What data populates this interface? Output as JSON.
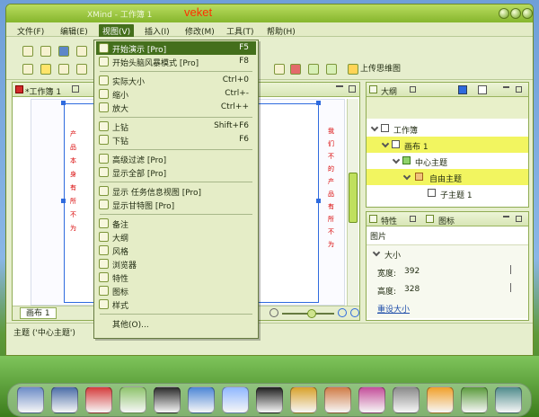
{
  "window": {
    "title": "XMind - 工作簿 1",
    "overlay": "veket"
  },
  "menu": {
    "items": [
      "文件(F)",
      "编辑(E)",
      "视图(V)",
      "插入(I)",
      "修改(M)",
      "工具(T)",
      "帮助(H)"
    ],
    "active_index": 2
  },
  "toolbar": {
    "upload_label": "上传思维图"
  },
  "editor": {
    "tab_label": "*工作簿 1",
    "sheet_tab": "画布 1",
    "red_left": "产 品 本 身 有 所 不 为",
    "red_right": "我 们 不 的 产 品 有 所 不 为"
  },
  "dropdown": {
    "items": [
      {
        "label": "开始演示 [Pro]",
        "shortcut": "F5",
        "icon": "presentation-icon",
        "hover": true
      },
      {
        "label": "开始头脑风暴模式 [Pro]",
        "shortcut": "F8",
        "icon": "brainstorm-icon"
      },
      {
        "separator": true
      },
      {
        "label": "实际大小",
        "shortcut": "Ctrl+0",
        "icon": "actual-size-icon"
      },
      {
        "label": "缩小",
        "shortcut": "Ctrl+-",
        "icon": "zoom-out-icon"
      },
      {
        "label": "放大",
        "shortcut": "Ctrl++",
        "icon": "zoom-in-icon"
      },
      {
        "separator": true
      },
      {
        "label": "上钻",
        "shortcut": "Shift+F6",
        "icon": "drill-up-icon"
      },
      {
        "label": "下钻",
        "shortcut": "F6",
        "icon": "drill-down-icon"
      },
      {
        "separator": true
      },
      {
        "label": "高级过滤 [Pro]",
        "shortcut": "",
        "icon": "filter-icon"
      },
      {
        "label": "显示全部 [Pro]",
        "shortcut": "",
        "icon": "show-all-icon"
      },
      {
        "separator": true
      },
      {
        "label": "显示 任务信息视图 [Pro]",
        "shortcut": "",
        "icon": "task-info-icon"
      },
      {
        "label": "显示甘特图 [Pro]",
        "shortcut": "",
        "icon": "gantt-icon"
      },
      {
        "separator": true
      },
      {
        "label": "备注",
        "shortcut": "",
        "icon": "notes-icon"
      },
      {
        "label": "大纲",
        "shortcut": "",
        "icon": "outline-icon"
      },
      {
        "label": "风格",
        "shortcut": "",
        "icon": "style-icon"
      },
      {
        "label": "浏览器",
        "shortcut": "",
        "icon": "browser-icon"
      },
      {
        "label": "特性",
        "shortcut": "",
        "icon": "properties-icon"
      },
      {
        "label": "图标",
        "shortcut": "",
        "icon": "markers-icon"
      },
      {
        "label": "样式",
        "shortcut": "",
        "icon": "palette-icon"
      },
      {
        "separator": true
      },
      {
        "label": "其他(O)...",
        "shortcut": "",
        "icon": ""
      }
    ]
  },
  "outline": {
    "title": "大纲",
    "rows": [
      {
        "label": "工作簿",
        "level": 0,
        "highlight": false
      },
      {
        "label": "画布 1",
        "level": 1,
        "highlight": true
      },
      {
        "label": "中心主题",
        "level": 2,
        "highlight": false
      },
      {
        "label": "自由主题",
        "level": 3,
        "highlight": true
      },
      {
        "label": "子主题 1",
        "level": 4,
        "highlight": false
      }
    ]
  },
  "properties": {
    "tabs": [
      "特性",
      "图标"
    ],
    "section": "图片",
    "group": "大小",
    "width_label": "宽度:",
    "width_value": "392",
    "height_label": "高度:",
    "height_value": "328",
    "reset_link": "重设大小"
  },
  "status": {
    "text": "主题 ('中心主题')"
  },
  "dock": {
    "items": [
      "paint-icon",
      "monitor-icon",
      "pet-icon",
      "notes-icon",
      "media-player-icon",
      "media-icon",
      "users-icon",
      "tux-icon",
      "folder-icon",
      "image-viewer-icon",
      "art-icon",
      "cable-icon",
      "paint-tool-icon",
      "recycle-icon",
      "camera-icon"
    ]
  },
  "colors": {
    "accent": "#446f1c",
    "highlight": "#f2f560",
    "overlay": "#ff2f00",
    "selection": "#2f6bde"
  }
}
